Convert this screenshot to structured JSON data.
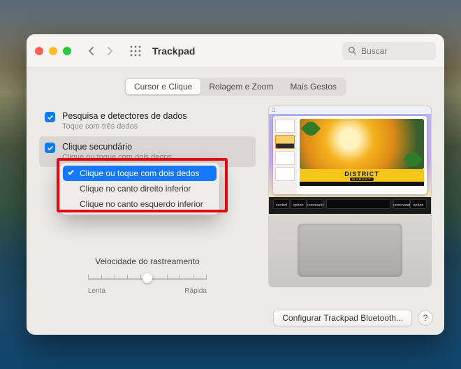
{
  "window": {
    "title": "Trackpad"
  },
  "search": {
    "placeholder": "Buscar"
  },
  "tabs": {
    "items": [
      {
        "label": "Cursor e Clique"
      },
      {
        "label": "Rolagem e Zoom"
      },
      {
        "label": "Mais Gestos"
      }
    ]
  },
  "options": {
    "research": {
      "label": "Pesquisa e detectores de dados",
      "sub": "Toque com três dedos"
    },
    "secondary": {
      "label": "Clique secundário",
      "sub": "Clique ou toque com dois dedos"
    }
  },
  "dropdown": {
    "items": [
      {
        "label": "Clique ou toque com dois dedos"
      },
      {
        "label": "Clique no canto direito inferior"
      },
      {
        "label": "Clique no canto esquerdo inferior"
      }
    ]
  },
  "slider": {
    "label": "Velocidade do rastreamento",
    "low": "Lenta",
    "high": "Rápida",
    "knob_pct": 50
  },
  "footer": {
    "bluetooth": "Configurar Trackpad Bluetooth...",
    "help": "?"
  },
  "preview": {
    "brand_top": "DISTRICT",
    "brand_sub": "MARKET",
    "keys": {
      "l1": "control",
      "l2": "option",
      "l3": "command",
      "r1": "command",
      "r2": "option"
    }
  }
}
